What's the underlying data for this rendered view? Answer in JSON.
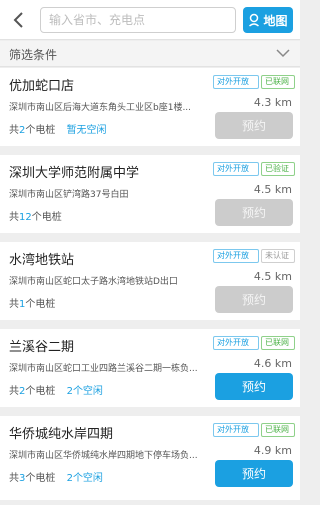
{
  "header": {
    "search_placeholder": "输入省市、充电点",
    "map_label": "地图"
  },
  "filter": {
    "label": "筛选条件"
  },
  "stations": [
    {
      "name": "优加蛇口店",
      "open_tag": "对外开放",
      "status_tag": "已联网",
      "status_color": "green",
      "address": "深圳市南山区后海大道东角头工业区b座1楼...",
      "distance": "4.3 km",
      "pile_prefix": "共",
      "pile_count": "2",
      "pile_suffix": "个电桩",
      "idle_text": "暂无空闲",
      "idle_count": "",
      "idle_suffix": "",
      "reserve_label": "预约",
      "reserve_enabled": false
    },
    {
      "name": "深圳大学师范附属中学",
      "open_tag": "对外开放",
      "status_tag": "已验证",
      "status_color": "green",
      "address": "深圳市南山区铲湾路37号白田",
      "distance": "4.5 km",
      "pile_prefix": "共",
      "pile_count": "12",
      "pile_suffix": "个电桩",
      "idle_text": "",
      "idle_count": "",
      "idle_suffix": "",
      "reserve_label": "预约",
      "reserve_enabled": false
    },
    {
      "name": "水湾地铁站",
      "open_tag": "对外开放",
      "status_tag": "未认证",
      "status_color": "gray",
      "address": "深圳市南山区蛇口太子路水湾地铁站D出口",
      "distance": "4.5 km",
      "pile_prefix": "共",
      "pile_count": "1",
      "pile_suffix": "个电桩",
      "idle_text": "",
      "idle_count": "",
      "idle_suffix": "",
      "reserve_label": "预约",
      "reserve_enabled": false
    },
    {
      "name": "兰溪谷二期",
      "open_tag": "对外开放",
      "status_tag": "已联网",
      "status_color": "green",
      "address": "深圳市南山区蛇口工业四路兰溪谷二期一栋负...",
      "distance": "4.6 km",
      "pile_prefix": "共",
      "pile_count": "2",
      "pile_suffix": "个电桩",
      "idle_text": "",
      "idle_count": "2",
      "idle_suffix": "个空闲",
      "reserve_label": "预约",
      "reserve_enabled": true
    },
    {
      "name": "华侨城纯水岸四期",
      "open_tag": "对外开放",
      "status_tag": "已联网",
      "status_color": "green",
      "address": "深圳市南山区华侨城纯水岸四期地下停车场负...",
      "distance": "4.9 km",
      "pile_prefix": "共",
      "pile_count": "3",
      "pile_suffix": "个电桩",
      "idle_text": "",
      "idle_count": "2",
      "idle_suffix": "个空闲",
      "reserve_label": "预约",
      "reserve_enabled": true
    }
  ],
  "colors": {
    "accent": "#1ba0e1",
    "disabled": "#cccccc",
    "verified": "#4fb34a"
  },
  "icons": {
    "back": "chevron-left-icon",
    "map": "location-pin-icon",
    "filter": "chevron-down-icon"
  }
}
